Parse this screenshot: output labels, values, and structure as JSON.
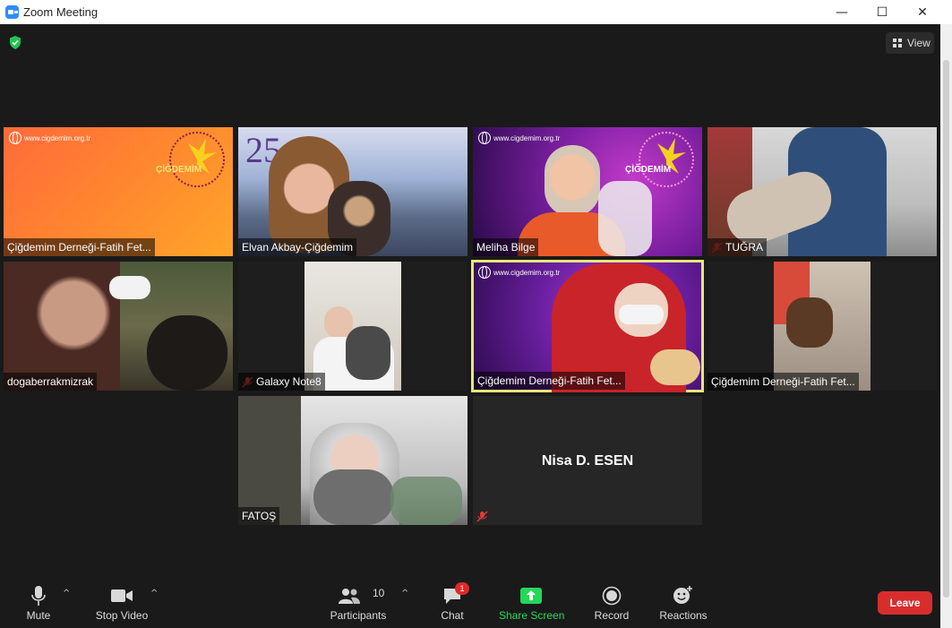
{
  "window": {
    "title": "Zoom Meeting",
    "minimize": "—",
    "maximize": "☐",
    "close": "✕"
  },
  "header": {
    "view_label": "View"
  },
  "tiles": [
    {
      "name": "Çiğdemim Derneği-Fatih Fet...",
      "url": "www.cigdemim.org.tr",
      "logo": "ÇİĞDEMİM",
      "muted": false
    },
    {
      "name": "Elvan Akbay-Çiğdemim",
      "overlay": "25",
      "muted": false
    },
    {
      "name": "Meliha Bilge",
      "url": "www.cigdemim.org.tr",
      "logo": "ÇİĞDEMİM",
      "muted": false
    },
    {
      "name": "TUĞRA",
      "muted": true
    },
    {
      "name": "dogaberrakmizrak",
      "muted": false
    },
    {
      "name": "Galaxy Note8",
      "muted": true
    },
    {
      "name": "Çiğdemim Derneği-Fatih Fet...",
      "url": "www.cigdemim.org.tr",
      "muted": false,
      "active_speaker": true
    },
    {
      "name": "Çiğdemim Derneği-Fatih Fet...",
      "muted": false
    },
    {
      "name": "FATOŞ",
      "muted": false
    },
    {
      "name": "Nisa D. ESEN",
      "muted": true,
      "video_off": true
    }
  ],
  "toolbar": {
    "mute": "Mute",
    "stop_video": "Stop Video",
    "participants": "Participants",
    "participants_count": "10",
    "chat": "Chat",
    "chat_badge": "1",
    "share_screen": "Share Screen",
    "record": "Record",
    "reactions": "Reactions",
    "leave": "Leave"
  },
  "colors": {
    "share_green": "#23d959",
    "leave_red": "#d92d2d",
    "active_speaker": "#e8e57a",
    "zoom_blue": "#2d8cff"
  }
}
